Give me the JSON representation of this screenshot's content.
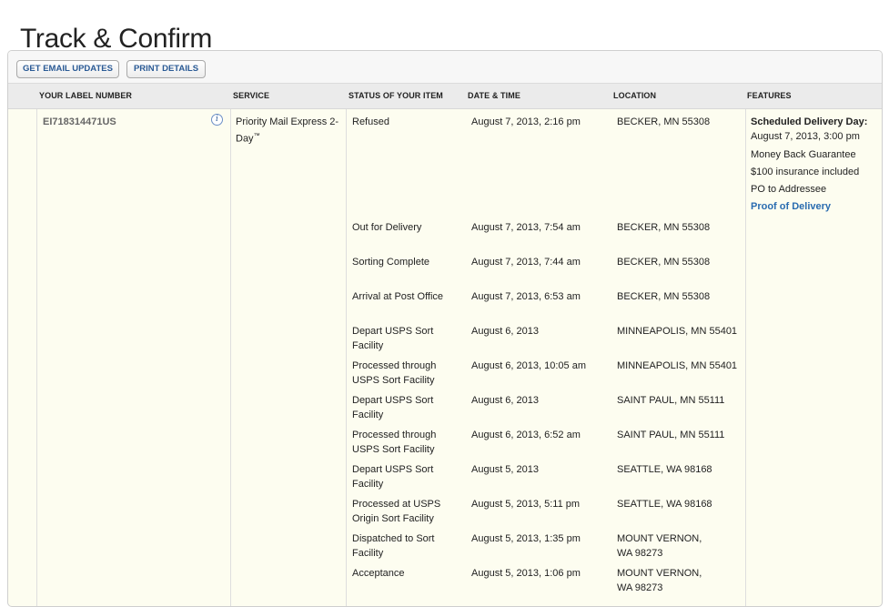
{
  "page": {
    "title": "Track & Confirm"
  },
  "toolbar": {
    "email_label": "GET EMAIL UPDATES",
    "print_label": "PRINT DETAILS"
  },
  "table": {
    "headers": [
      "YOUR LABEL NUMBER",
      "SERVICE",
      "STATUS OF YOUR ITEM",
      "DATE & TIME",
      "LOCATION",
      "FEATURES"
    ],
    "label_number": "EI718314471US",
    "info_icon": "info-icon",
    "service": "Priority Mail Express 2-Day",
    "service_mark": "™",
    "events": [
      {
        "status": "Refused",
        "datetime": "August 7, 2013, 2:16 pm",
        "location": "BECKER, MN 55308"
      },
      {
        "status": "Out for Delivery",
        "datetime": "August 7, 2013, 7:54 am",
        "location": "BECKER, MN 55308"
      },
      {
        "status": "Sorting Complete",
        "datetime": "August 7, 2013, 7:44 am",
        "location": "BECKER, MN 55308"
      },
      {
        "status": "Arrival at Post Office",
        "datetime": "August 7, 2013, 6:53 am",
        "location": "BECKER, MN 55308"
      },
      {
        "status": "Depart USPS Sort Facility",
        "datetime": "August 6, 2013",
        "location": "MINNEAPOLIS, MN 55401"
      },
      {
        "status": "Processed through USPS Sort Facility",
        "datetime": "August 6, 2013, 10:05 am",
        "location": "MINNEAPOLIS, MN 55401"
      },
      {
        "status": "Depart USPS Sort Facility",
        "datetime": "August 6, 2013",
        "location": "SAINT PAUL, MN 55111"
      },
      {
        "status": "Processed through USPS Sort Facility",
        "datetime": "August 6, 2013, 6:52 am",
        "location": "SAINT PAUL, MN 55111"
      },
      {
        "status": "Depart USPS Sort Facility",
        "datetime": "August 5, 2013",
        "location": "SEATTLE, WA 98168"
      },
      {
        "status": "Processed at USPS Origin Sort Facility",
        "datetime": "August 5, 2013, 5:11 pm",
        "location": "SEATTLE, WA 98168"
      },
      {
        "status": "Dispatched to Sort Facility",
        "datetime": "August 5, 2013, 1:35 pm",
        "location": "MOUNT VERNON, WA 98273"
      },
      {
        "status": "Acceptance",
        "datetime": "August 5, 2013, 1:06 pm",
        "location": "MOUNT VERNON, WA 98273"
      }
    ],
    "features": {
      "heading": "Scheduled Delivery Day:",
      "delivery_date": "August 7, 2013, 3:00 pm",
      "items": [
        "Money Back Guarantee",
        "$100 insurance included",
        "PO to Addressee"
      ],
      "link": "Proof of Delivery"
    }
  },
  "colors": {
    "accent": "#2a5a95",
    "row_background": "#fdfdf0",
    "header_background": "#ebebeb"
  }
}
